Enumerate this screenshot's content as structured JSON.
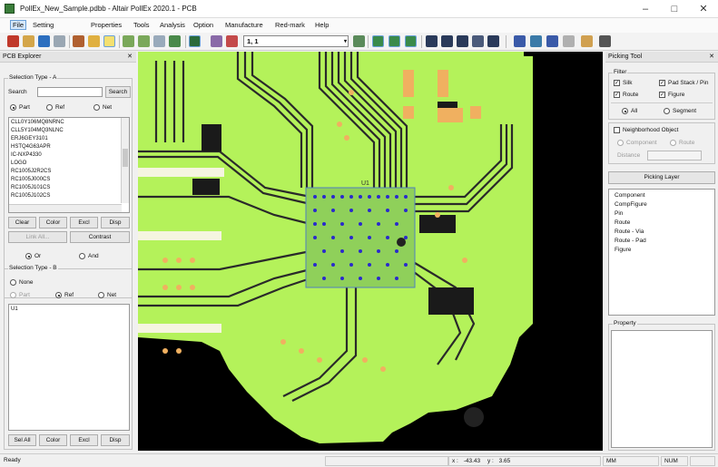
{
  "window": {
    "title": "PollEx_New_Sample.pdbb - Altair PollEx 2020.1 - PCB",
    "minimize_glyph": "–",
    "maximize_glyph": "□",
    "close_glyph": "✕"
  },
  "menu": [
    "File",
    "Setting",
    "Properties",
    "Tools",
    "Analysis",
    "Option",
    "Manufacture",
    "Red-mark",
    "Help"
  ],
  "toolbar": {
    "coord_value": "1, 1",
    "dropdown_glyph": "▾"
  },
  "explorer": {
    "title": "PCB Explorer",
    "close_glyph": "✕",
    "selection_a": {
      "label": "Selection Type - A",
      "search_label": "Search",
      "search_value": "",
      "search_button": "Search",
      "radios": [
        "Part",
        "Ref",
        "Net"
      ],
      "selected": "Part",
      "parts": [
        "CLL0Y106MQ8NRNC",
        "CLL5Y104MQ3NLNC",
        "ERJ6GEY3101",
        "HSTQ4G63APR",
        "IC-NXP4330",
        "LOGO",
        "RC1005J2R2CS",
        "RC1005J000CS",
        "RC1005J101CS",
        "RC1005J102CS"
      ],
      "buttons": [
        "Clear",
        "Color",
        "Excl",
        "Disp"
      ],
      "button_link": "Link All...",
      "button_contrast": "Contrast"
    },
    "combine": {
      "or": "Or",
      "and": "And",
      "selected": "Or"
    },
    "selection_b": {
      "label": "Selection Type - B",
      "none": "None",
      "radios": [
        "Part",
        "Ref",
        "Net"
      ],
      "selected": "Ref",
      "items": [
        "U1"
      ],
      "buttons": [
        "Sel All",
        "Color",
        "Excl",
        "Disp"
      ]
    }
  },
  "picking": {
    "title": "Picking Tool",
    "close_glyph": "✕",
    "filter": {
      "label": "Filter",
      "checks": [
        "Silk",
        "Pad Stack / Pin",
        "Route",
        "Figure"
      ],
      "all": "All",
      "segment": "Segment"
    },
    "neighborhood": "Neighborhood Object",
    "component": "Component",
    "route": "Route",
    "distance": "Distance",
    "picking_layer_button": "Picking Layer",
    "tree": [
      "Component",
      "CompFigure",
      "Pin",
      "Route",
      "Route - Via",
      "Route - Pad",
      "Figure"
    ],
    "property": "Property"
  },
  "pcb": {
    "ref_label": "U1",
    "colors": {
      "board": "#b4f25a",
      "background": "#000000",
      "trace": "#2a2a2a",
      "pad": "#f0b060",
      "via": "#2a2acc",
      "silk": "#f5f5e0"
    }
  },
  "status": {
    "ready": "Ready",
    "x_label": "x :",
    "x_value": "-43.43",
    "y_label": "y :",
    "y_value": "3.65",
    "units": "MM",
    "numlock": "NUM"
  }
}
